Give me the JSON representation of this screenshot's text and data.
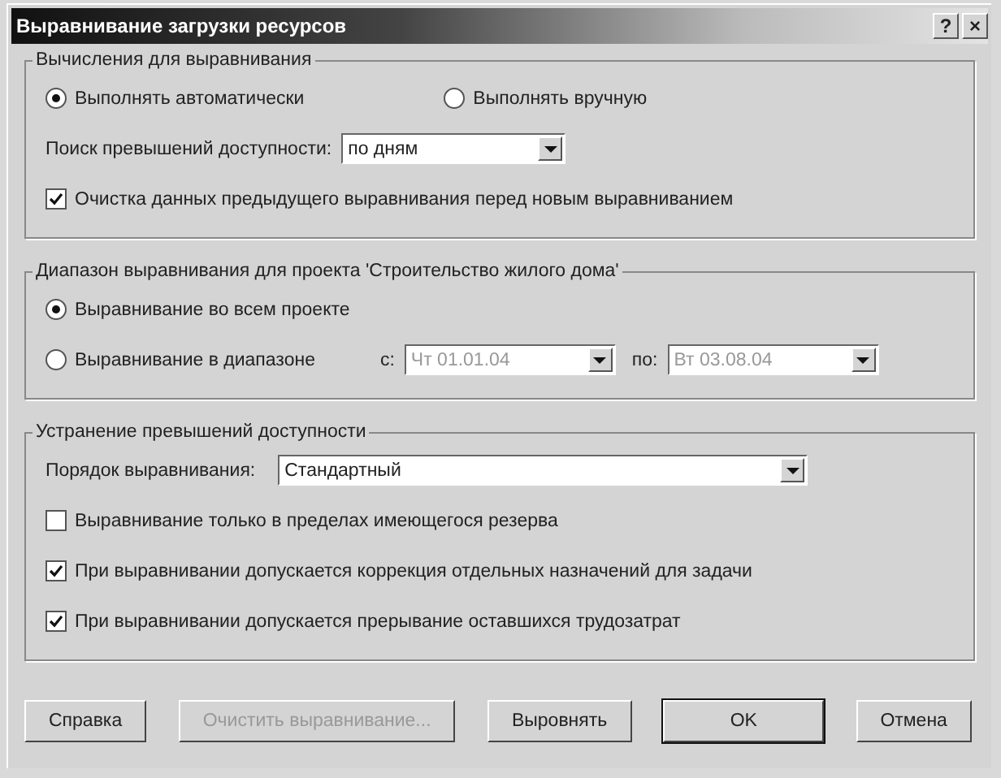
{
  "window": {
    "title": "Выравнивание загрузки ресурсов",
    "title_buttons": [
      "?",
      "×"
    ]
  },
  "groups": [
    {
      "title": "Вычисления для выравнивания",
      "items": [
        {
          "kind": "radios",
          "options": [
            {
              "label": "Выполнять автоматически",
              "selected": true
            },
            {
              "label": "Выполнять вручную",
              "selected": false
            }
          ]
        },
        {
          "kind": "select",
          "label": "Поиск превышений доступности:",
          "value": "по дням",
          "wide": false
        },
        {
          "kind": "checkbox",
          "label": "Очистка данных предыдущего выравнивания перед новым выравниванием",
          "checked": true
        }
      ]
    },
    {
      "title": "Диапазон выравнивания для проекта 'Строительство жилого дома'",
      "items": [
        {
          "kind": "radios",
          "options": [
            {
              "label": "Выравнивание во всем проекте",
              "selected": true
            }
          ]
        },
        {
          "kind": "range",
          "label": "Выравнивание в диапазоне",
          "selected": false,
          "from_label": "с:",
          "from_value": "Чт 01.01.04",
          "to_label": "по:",
          "to_value": "Вт 03.08.04",
          "disabled": true
        }
      ]
    },
    {
      "title": "Устранение превышений доступности",
      "items": [
        {
          "kind": "select",
          "label": "Порядок выравнивания:",
          "value": "Стандартный",
          "wide": true
        },
        {
          "kind": "checkbox",
          "label": "Выравнивание только в пределах имеющегося резерва",
          "checked": false
        },
        {
          "kind": "checkbox",
          "label": "При выравнивании допускается коррекция отдельных назначений для задачи",
          "checked": true
        },
        {
          "kind": "checkbox",
          "label": "При выравнивании допускается прерывание оставшихся трудозатрат",
          "checked": true
        }
      ]
    }
  ],
  "buttons": [
    {
      "label": "Справка",
      "disabled": false,
      "default": false
    },
    {
      "label": "Очистить выравнивание...",
      "disabled": true,
      "default": false
    },
    {
      "label": "Выровнять",
      "disabled": false,
      "default": false
    },
    {
      "label": "OK",
      "disabled": false,
      "default": true
    },
    {
      "label": "Отмена",
      "disabled": false,
      "default": false
    }
  ]
}
